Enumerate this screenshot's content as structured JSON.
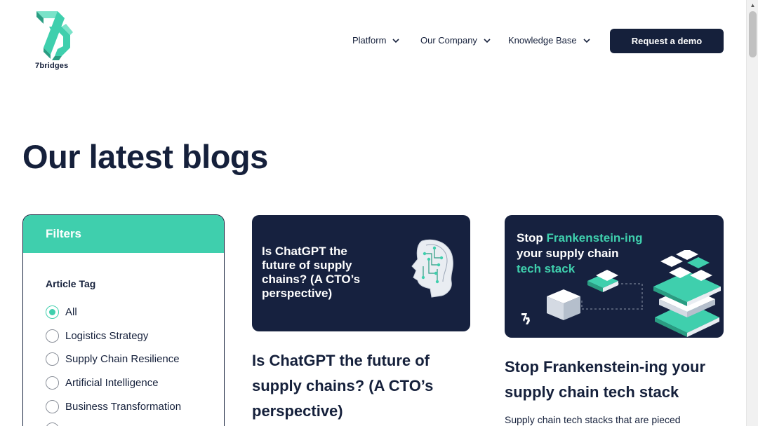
{
  "header": {
    "logo_text": "7bridges",
    "nav": [
      {
        "label": "Platform"
      },
      {
        "label": "Our Company"
      },
      {
        "label": "Knowledge Base"
      }
    ],
    "cta_label": "Request a demo",
    "icon": "chevron-down-icon"
  },
  "main": {
    "title": "Our latest blogs",
    "filters": {
      "heading": "Filters",
      "subheading": "Article Tag",
      "options": [
        {
          "label": "All",
          "selected": true
        },
        {
          "label": "Logistics Strategy",
          "selected": false
        },
        {
          "label": "Supply Chain Resilience",
          "selected": false
        },
        {
          "label": "Artificial Intelligence",
          "selected": false
        },
        {
          "label": "Business Transformation",
          "selected": false
        }
      ]
    },
    "posts": [
      {
        "image_text": [
          "Is ChatGPT the",
          "future of supply",
          "chains? (A CTO’s",
          "perspective)"
        ],
        "title_lines": [
          "Is ChatGPT the future of",
          "supply chains? (A CTO’s",
          "perspective)"
        ]
      },
      {
        "image_text_white_1": "Stop ",
        "image_text_teal_1": "Frankenstein-ing",
        "image_text_white_2": "your supply chain",
        "image_text_teal_3": "tech stack",
        "title_lines": [
          "Stop Frankenstein-ing your",
          "supply chain tech stack"
        ],
        "excerpt": "Supply chain tech stacks that are pieced"
      }
    ]
  },
  "colors": {
    "navy": "#15203b",
    "teal": "#3fcfad"
  }
}
